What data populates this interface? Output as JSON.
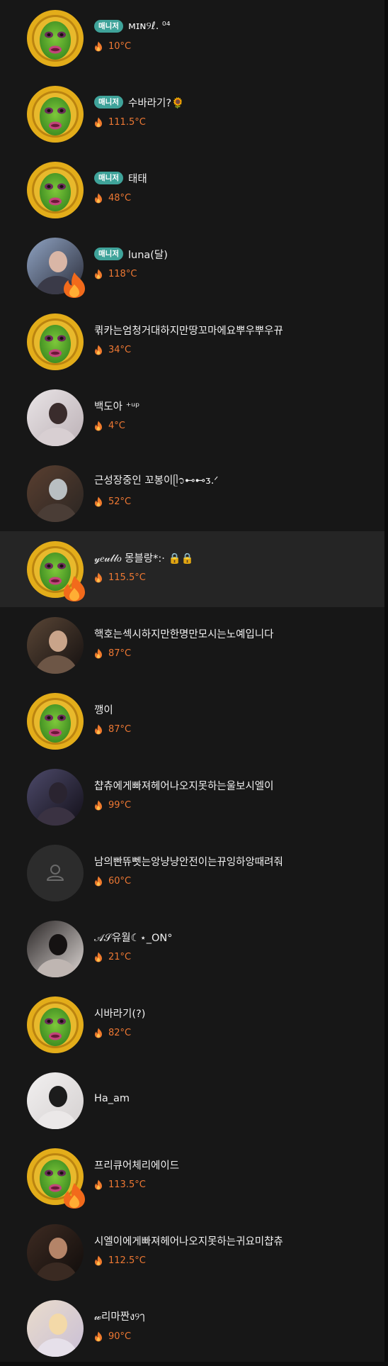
{
  "colors": {
    "background": "#171717",
    "selected_row": "#252525",
    "manager_badge": "#3fa39a",
    "temperature": "#ee7833",
    "name_text": "#f1f1f1"
  },
  "members": [
    {
      "name": "ᴍɪɴ୨ℓ. ⁰⁴",
      "badge": "매니저",
      "temp": "10°C",
      "avatar": "green-face-gold-ring",
      "fire": false,
      "selected": false
    },
    {
      "name": "수바라기?🌻",
      "badge": "매니저",
      "temp": "111.5°C",
      "avatar": "green-face-gold-ring",
      "fire": false,
      "selected": false
    },
    {
      "name": "태태",
      "badge": "매니저",
      "temp": "48°C",
      "avatar": "green-face-gold-ring",
      "fire": false,
      "selected": false
    },
    {
      "name": "luna(달)",
      "badge": "매니저",
      "temp": "118°C",
      "avatar": "photo-couple-blue",
      "fire": true,
      "selected": false
    },
    {
      "name": "퀶카는엄청거대하지만땅꼬마에요뿌우뿌우뀨",
      "badge": "",
      "temp": "34°C",
      "avatar": "green-face-gold-ring",
      "fire": false,
      "selected": false
    },
    {
      "name": "백도아 ⁺ᵘᵖ",
      "badge": "",
      "temp": "4°C",
      "avatar": "photo-light-girl",
      "fire": false,
      "selected": false
    },
    {
      "name": "근성장중인 꼬봉이ᥫ᭡⊷⊷ᴣ.ᐟ",
      "badge": "",
      "temp": "52°C",
      "avatar": "photo-brown-blur",
      "fire": false,
      "selected": false
    },
    {
      "name": "𝓎𝑒𝓊𝓁𝓁𝑜 몽블랑*:· 🔒🔒",
      "badge": "",
      "temp": "115.5°C",
      "avatar": "green-face-gold-ring",
      "fire": true,
      "selected": true
    },
    {
      "name": "핵호는섹시하지만한명만모시는노예입니다",
      "badge": "",
      "temp": "87°C",
      "avatar": "photo-dark-figure",
      "fire": false,
      "selected": false
    },
    {
      "name": "깽이",
      "badge": "",
      "temp": "87°C",
      "avatar": "green-face-gold-ring",
      "fire": false,
      "selected": false
    },
    {
      "name": "챱츄에게빠져헤어나오지못하는울보시엘이",
      "badge": "",
      "temp": "99°C",
      "avatar": "photo-night-couple",
      "fire": false,
      "selected": false
    },
    {
      "name": "남의빤뜌뻿는앙냥냥안전이는뀨잉하앙때려줘",
      "badge": "",
      "temp": "60°C",
      "avatar": "default-user",
      "fire": false,
      "selected": false
    },
    {
      "name": "𝒜𝒮유월☾⋆_ON°",
      "badge": "",
      "temp": "21°C",
      "avatar": "photo-mirror-selfie",
      "fire": false,
      "selected": false
    },
    {
      "name": "시바라기(?)",
      "badge": "",
      "temp": "82°C",
      "avatar": "green-face-gold-ring",
      "fire": false,
      "selected": false
    },
    {
      "name": "Ha_am",
      "badge": "",
      "temp": "",
      "avatar": "photo-white-girl",
      "fire": false,
      "selected": false
    },
    {
      "name": "프리큐어체리에이드",
      "badge": "",
      "temp": "113.5°C",
      "avatar": "green-face-gold-ring",
      "fire": true,
      "selected": false
    },
    {
      "name": "시엘이에게빠져헤어나오지못하는귀요미챱츄",
      "badge": "",
      "temp": "112.5°C",
      "avatar": "photo-couple-dark",
      "fire": false,
      "selected": false
    },
    {
      "name": "𝓌리마짠ง୨ๅ",
      "badge": "",
      "temp": "90°C",
      "avatar": "photo-blonde-girl",
      "fire": false,
      "selected": false
    }
  ]
}
